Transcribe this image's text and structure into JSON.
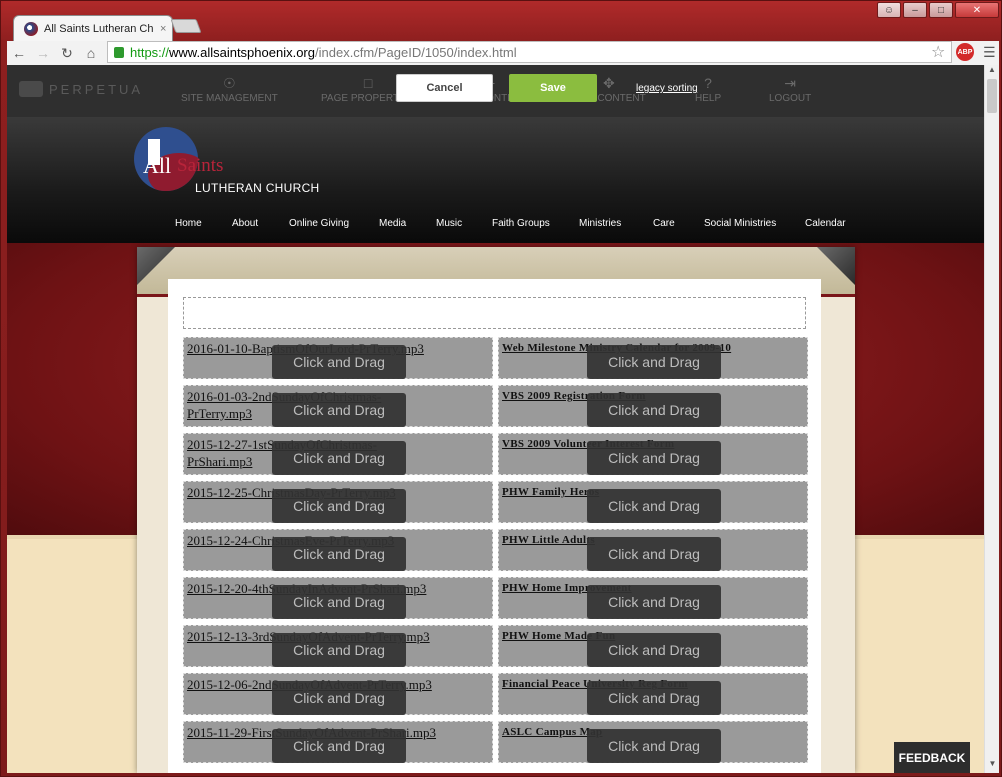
{
  "browser": {
    "tab_title": "All Saints Lutheran Church",
    "tab_close": "×",
    "url_scheme": "https://",
    "url_host": "www.allsaintsphoenix.org",
    "url_path": "/index.cfm/PageID/1050/index.html",
    "abp_label": "ABP"
  },
  "cms": {
    "brand": "PERPETUA",
    "menu": [
      {
        "label": "SITE MANAGEMENT",
        "icon": "globe-icon"
      },
      {
        "label": "PAGE PROPERTIES",
        "icon": "document-icon"
      },
      {
        "label": "ADD CONTENT",
        "icon": "plus-icon"
      },
      {
        "label": "EDIT CONTENT",
        "icon": "move-icon"
      },
      {
        "label": "HELP",
        "icon": "help-icon"
      },
      {
        "label": "LOGOUT",
        "icon": "logout-icon"
      }
    ],
    "cancel_label": "Cancel",
    "save_label": "Save",
    "legacy_label": "legacy sorting"
  },
  "site": {
    "logo_all": "All",
    "logo_saints": "Saints",
    "logo_sub": "LUTHERAN CHURCH",
    "nav": [
      "Home",
      "About",
      "Online Giving",
      "Media",
      "Music",
      "Faith Groups",
      "Ministries",
      "Care",
      "Social Ministries",
      "Calendar"
    ]
  },
  "drag_label": "Click and Drag",
  "left_items": [
    "2016-01-10-BaptismOfOurLord-PrTerry.mp3",
    "2016-01-03-2ndSundayOfChristmas-PrTerry.mp3",
    "2015-12-27-1stSundayOfChristmas-PrShari.mp3",
    "2015-12-25-ChristmasDay-PrTerry.mp3",
    "2015-12-24-ChristmasEve-PrTerry.mp3",
    "2015-12-20-4thSundayInAdvent-PrShari.mp3",
    "2015-12-13-3rdSundayOfAdvent-PrTerry.mp3",
    "2015-12-06-2ndSundayOfAdvent-PrTerry.mp3",
    "2015-11-29-FirstSundayOfAdvent-PrShari.mp3"
  ],
  "right_items": [
    "Web Milestone Ministry Calendar for 2009-10",
    "VBS 2009 Registration Form",
    "VBS 2009 Volunteer Interest Form",
    "PHW Family Heros",
    "PHW Little Adults",
    "PHW Home Improvement",
    "PHW Home Made Fun",
    "Financial Peace University Reg Form",
    "ASLC Campus Map"
  ],
  "feedback_label": "FEEDBACK"
}
